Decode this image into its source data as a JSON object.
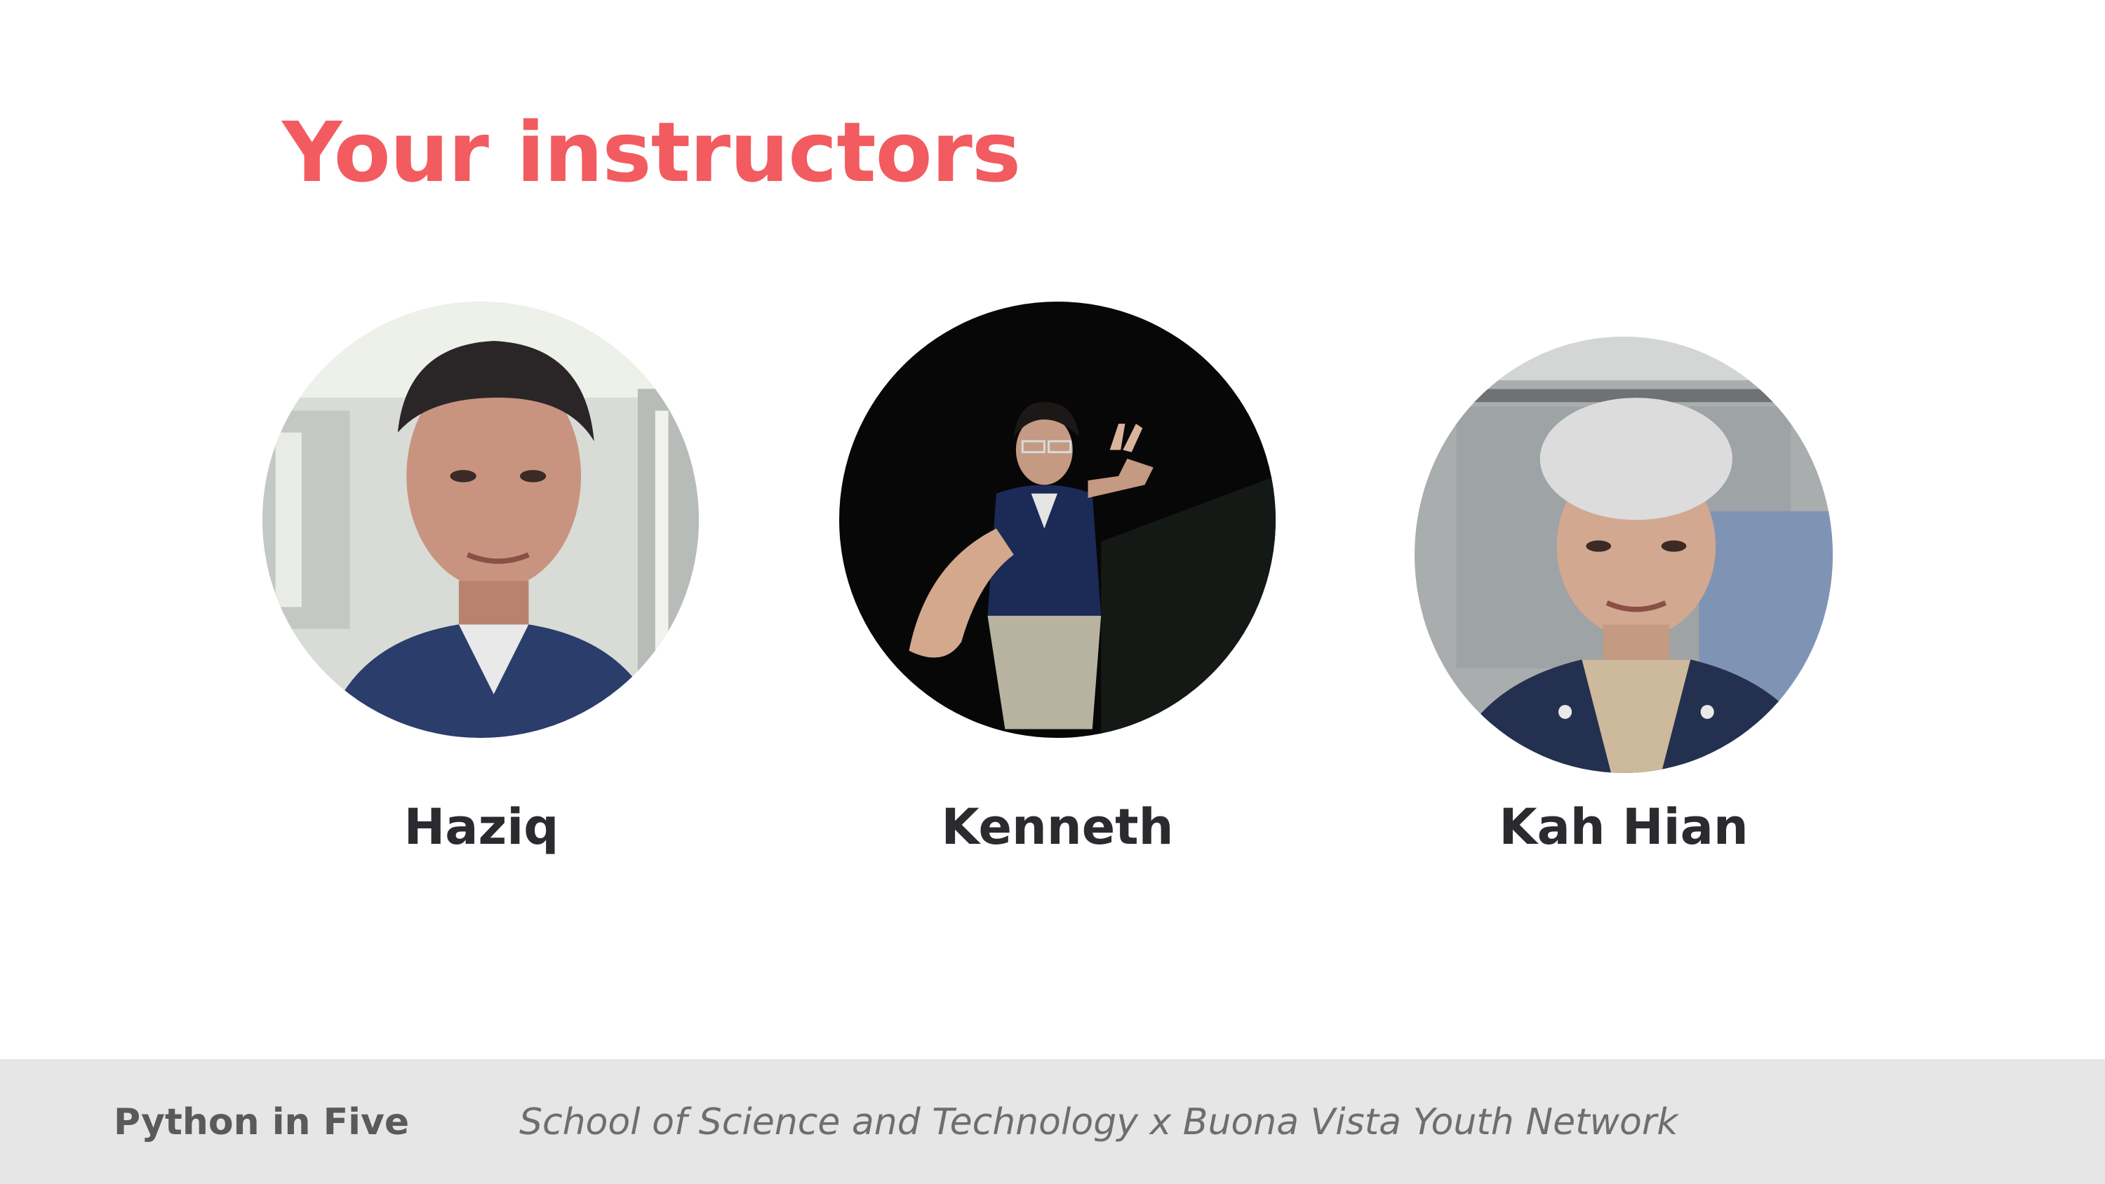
{
  "slide": {
    "title": "Your instructors"
  },
  "instructors": [
    {
      "name": "Haziq",
      "photo_alt": "Photo of Haziq"
    },
    {
      "name": "Kenneth",
      "photo_alt": "Photo of Kenneth"
    },
    {
      "name": "Kah Hian",
      "photo_alt": "Photo of Kah Hian"
    }
  ],
  "footer": {
    "course": "Python in Five",
    "organizations": "School of Science and Technology x Buona Vista Youth Network"
  },
  "colors": {
    "title": "#f25b5f",
    "name_text": "#2b2b2f",
    "footer_bg": "#e6e6e6",
    "footer_text": "#5a5a5a"
  }
}
